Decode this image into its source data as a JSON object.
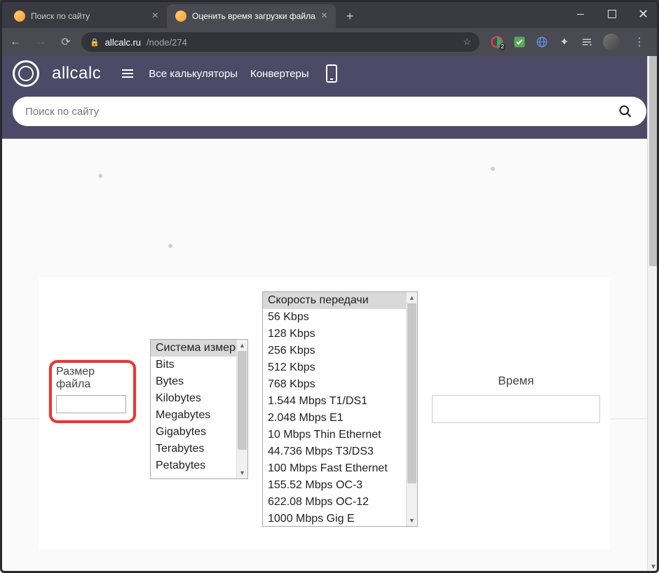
{
  "window": {
    "tabs": [
      {
        "title": "Поиск по сайту",
        "active": false
      },
      {
        "title": "Оценить время загрузки файла",
        "active": true
      }
    ]
  },
  "address": {
    "domain": "allcalc.ru",
    "path": "/node/274",
    "badge_count": "2"
  },
  "site_nav": {
    "logo": "allcalc",
    "all_calculators": "Все калькуляторы",
    "converters": "Конвертеры"
  },
  "search": {
    "placeholder": "Поиск по сайту"
  },
  "calculator": {
    "file_size_label": "Размер файла",
    "units": {
      "header": "Система измере",
      "options": [
        "Bits",
        "Bytes",
        "Kilobytes",
        "Megabytes",
        "Gigabytes",
        "Terabytes",
        "Petabytes"
      ]
    },
    "speed": {
      "header": "Скорость передачи",
      "options": [
        "56 Kbps",
        "128 Kbps",
        "256 Kbps",
        "512 Kbps",
        "768 Kbps",
        "1.544 Mbps T1/DS1",
        "2.048 Mbps E1",
        "10 Mbps Thin Ethernet",
        "44.736 Mbps T3/DS3",
        "100 Mbps Fast Ethernet",
        "155.52 Mbps OC-3",
        "622.08 Mbps OC-12",
        "1000 Mbps Gig E"
      ]
    },
    "time_label": "Время"
  }
}
